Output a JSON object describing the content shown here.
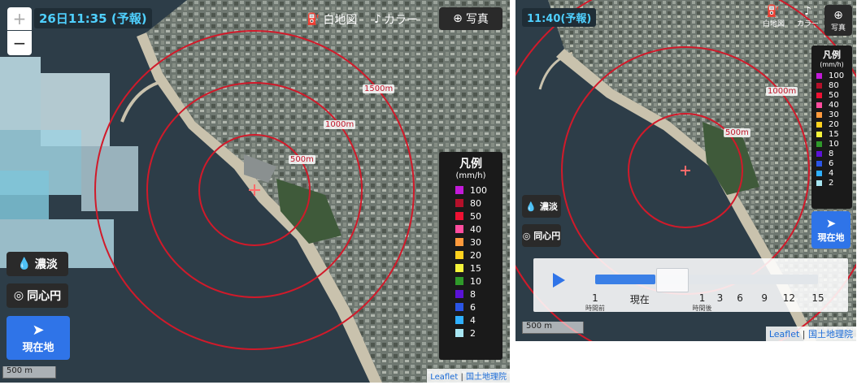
{
  "left": {
    "time_badge": "26日11:35 (予報)",
    "zoom_in": "+",
    "zoom_out": "−",
    "top_buttons": {
      "white_map": "白地図",
      "color": "カラー",
      "photo": "写真"
    },
    "legend": {
      "title": "凡例",
      "unit": "(mm/h)",
      "items": [
        {
          "label": "100",
          "color": "#c21ad8"
        },
        {
          "label": "80",
          "color": "#b4102a"
        },
        {
          "label": "50",
          "color": "#ee1133"
        },
        {
          "label": "40",
          "color": "#ff4c9e"
        },
        {
          "label": "30",
          "color": "#ff9a3c"
        },
        {
          "label": "20",
          "color": "#ffd21e"
        },
        {
          "label": "15",
          "color": "#f5f53a"
        },
        {
          "label": "10",
          "color": "#2f9a2a"
        },
        {
          "label": "8",
          "color": "#5a12d6"
        },
        {
          "label": "6",
          "color": "#2a55e6"
        },
        {
          "label": "4",
          "color": "#2fb0ff"
        },
        {
          "label": "2",
          "color": "#a8e6f2"
        }
      ]
    },
    "ring_labels": [
      "500m",
      "1000m",
      "1500m"
    ],
    "density_btn": "濃淡",
    "concentric_btn": "同心円",
    "locate_btn": "現在地",
    "scale": "500 m",
    "attribution": {
      "leaflet": "Leaflet",
      "sep": " | ",
      "gsi": "国土地理院"
    }
  },
  "right": {
    "time_badge": "11:40(予報)",
    "top_buttons": {
      "white_map": "白地図",
      "color": "カラー",
      "photo": "写真"
    },
    "legend": {
      "title": "凡例",
      "unit": "(mm/h)",
      "items": [
        {
          "label": "100",
          "color": "#c21ad8"
        },
        {
          "label": "80",
          "color": "#b4102a"
        },
        {
          "label": "50",
          "color": "#ee1133"
        },
        {
          "label": "40",
          "color": "#ff4c9e"
        },
        {
          "label": "30",
          "color": "#ff9a3c"
        },
        {
          "label": "20",
          "color": "#ffd21e"
        },
        {
          "label": "15",
          "color": "#f5f53a"
        },
        {
          "label": "10",
          "color": "#2f9a2a"
        },
        {
          "label": "8",
          "color": "#5a12d6"
        },
        {
          "label": "6",
          "color": "#2a55e6"
        },
        {
          "label": "4",
          "color": "#2fb0ff"
        },
        {
          "label": "2",
          "color": "#a8e6f2"
        }
      ]
    },
    "ring_labels": [
      "500m",
      "1000m"
    ],
    "density_btn": "濃淡",
    "concentric_btn": "同心円",
    "locate_btn": "現在地",
    "timeline": {
      "progress": 0.27,
      "ticks": [
        {
          "label": "1",
          "sub": "時間前"
        },
        {
          "label": "現在",
          "sub": ""
        },
        {
          "label": "1",
          "sub": "時間後"
        },
        {
          "label": "3",
          "sub": ""
        },
        {
          "label": "6",
          "sub": ""
        },
        {
          "label": "9",
          "sub": ""
        },
        {
          "label": "12",
          "sub": ""
        },
        {
          "label": "15",
          "sub": ""
        }
      ]
    },
    "scale": "500 m",
    "attribution": {
      "leaflet": "Leaflet",
      "sep": " | ",
      "gsi": "国土地理院"
    }
  }
}
